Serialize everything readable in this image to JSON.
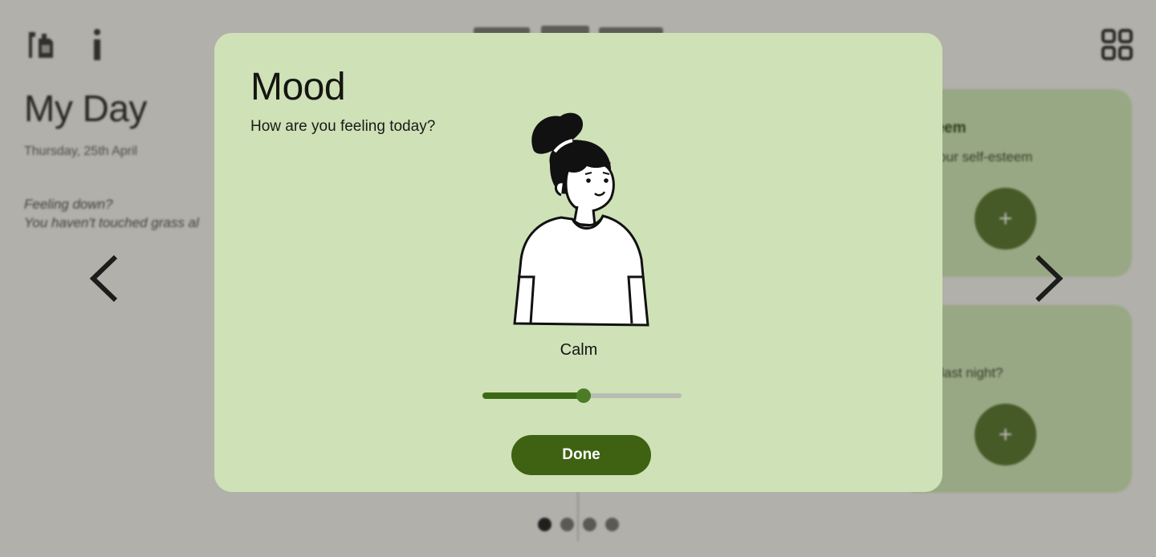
{
  "header": {
    "title": "My Day",
    "date": "Thursday, 25th April"
  },
  "hint": {
    "line1": "Feeling down?",
    "line2": "You haven't touched grass al"
  },
  "cards": [
    {
      "title": "esteem",
      "question_line1": "as your self-esteem",
      "question_line2": "?",
      "add_label": "+"
    },
    {
      "title": "",
      "question_line1": "well last night?",
      "question_line2": "",
      "add_label": "+"
    }
  ],
  "pager": {
    "pages": 4,
    "active_index": 0
  },
  "modal": {
    "title": "Mood",
    "question": "How are you feeling today?",
    "mood_label": "Calm",
    "slider": {
      "min": 0,
      "max": 1,
      "value": 0.51
    },
    "done_label": "Done"
  },
  "colors": {
    "modal_bg": "#cfe1b7",
    "accent": "#3e6211",
    "card_bg": "#cde6b1",
    "scrim": "rgba(60,58,52,0.36)"
  },
  "icons": [
    "bottle-jar-icon",
    "info-icon",
    "grid-icon",
    "chevron-left-icon",
    "chevron-right-icon",
    "plus-icon"
  ]
}
